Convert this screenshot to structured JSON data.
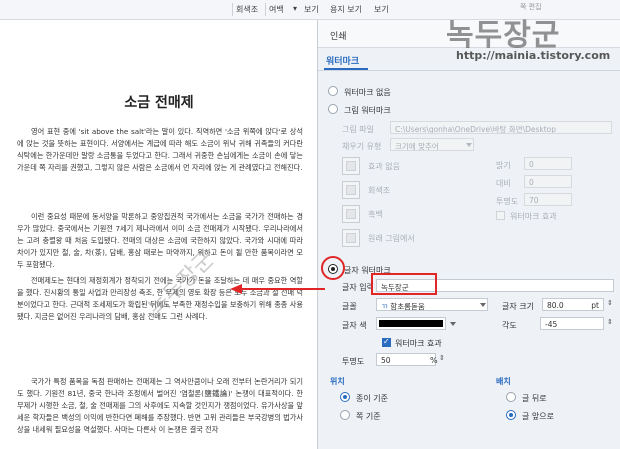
{
  "toolbar": {
    "items": [
      "회색조",
      "여백",
      "보기",
      "용지 보기",
      "보기"
    ]
  },
  "document": {
    "title": "소금 전매제",
    "paragraphs": [
      "영어 표현 중에 'sit above the salt'라는 말이 있다. 직역하면 '소금 위쪽에 앉다'로 상석에 앉는 것을 뜻하는 표현이다. 서양에서는 계급에 따라 해도 소금이 위낙 귀해 귀족들의 커다란 식탁에는 한가운데만 말랑 소금통을 두었다고 한다. 그래서 귀중한 손님에게는 소금이 손에 닿는 가운데 쪽 자리를 권했고, 그렇지 않은 사람은 소금에서 먼 자리에 앉는 게 관례였다고 전해진다.",
      "이런 중요성 때문에 동서양을 막론하고 중앙집권적 국가에서는 소금을 국가가 전매하는 경우가 많았다. 중국에서는 기원전 7세기 제나라에서 이미 소금 전매제가 시작됐다. 우리나라에서는 고려 충렬왕 때 처음 도입됐다. 전매의 대상은 소금에 국한하지 않았다. 국가와 시대에 따라 차이가 있지만 철, 술, 차(茶), 담배, 홍삼 때로는 마약까지, 위하고 돈이 될 만한 품목이라면 모두 포함됐다.",
      "전매제도는 현대의 재정회계가 정착되기 전에는 국가가 돈을 조달하는 데 매우 중요한 역할을 했다. 진시황의 통일 사업과 만리장성 축조, 한 무제의 영토 확장 등은 모두 소금과 철 전매 덕분이었다고 한다. 근대적 조세제도가 확립된 뒤에도 부족한 재정수입을 보충하기 위해 종종 사용됐다. 지금은 없어진 우리나라의 담배, 홍삼 전매도 그런 사례다.",
      "국가가 특정 품목을 독점 판매하는 전매제는 그 역사만큼이나 오래 전부터 논란거리가 되기도 했다. 기원전 81년, 중국 한나라 조정에서 벌어진 '염철론(鹽鐵論)' 논쟁이 대표적이다. 한 무제가 시행한 소금, 철, 술 전매제를 그의 사후에도 지속할 것인지가 쟁점이었다. 유가사상을 앞세운 학자들은 백성의 이익에 반한다면 폐해를 주장했다. 반면 고위 관리들은 부국강병의 법가사상을 내세워 필요성을 역설했다. 사마는 다른사 이 논쟁은 결국 전자"
    ],
    "watermark_text": "녹두장군"
  },
  "dialog": {
    "title": "인쇄",
    "tab": "워터마크",
    "options": {
      "none": "워터마크 없음",
      "picture": "그림 워터마크",
      "text": "글자 워터마크"
    },
    "picture": {
      "file_label": "그림 파일",
      "file_value": "C:\\Users\\gonha\\OneDrive\\바탕 화면\\Desktop",
      "fill_label": "채우기 유형",
      "fill_value": "크기에 맞추어",
      "effect_label": "효과 없음",
      "gray_label": "회색조",
      "bw_label": "흑백",
      "original_label": "원래 그림에서",
      "brightness_label": "밝기",
      "brightness_value": "0",
      "contrast_label": "대비",
      "contrast_value": "0",
      "transparency_label": "투명도",
      "transparency_value": "70",
      "wm_effect_label": "워터마크 효과"
    },
    "text": {
      "input_label": "글자 입력",
      "input_value": "녹두장군",
      "font_label": "글꼴",
      "font_value": "함초롬돋움",
      "font_prefix": "ㄲ",
      "size_label": "글자 크기",
      "size_value": "80.0",
      "size_unit": "pt",
      "color_label": "글자 색",
      "color_value": "#000000",
      "angle_label": "각도",
      "angle_value": "-45",
      "wm_effect_label": "워터마크 효과",
      "transparency_label": "투명도",
      "transparency_value": "50",
      "transparency_unit": "%"
    },
    "position": {
      "title": "위치",
      "options": [
        "종이 기준",
        "쪽 기준"
      ],
      "selected": 0
    },
    "arrangement": {
      "title": "배치",
      "options": [
        "글 뒤로",
        "글 앞으로"
      ],
      "selected": 1
    }
  },
  "brand": {
    "logo_text": "녹두장군",
    "url": "http://mainia.tistory.com",
    "small_text": "쪽 편집"
  },
  "colors": {
    "accent": "#2a6bbf",
    "highlight": "#e02626"
  }
}
